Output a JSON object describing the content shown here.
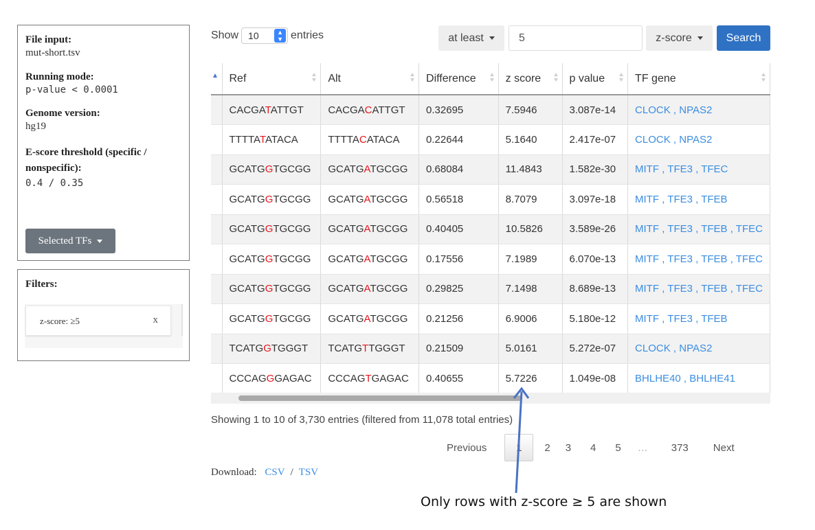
{
  "panel": {
    "file_input_label": "File input:",
    "file_input_value": "mut-short.tsv",
    "running_mode_label": "Running mode:",
    "running_mode_value": "p-value < 0.0001",
    "genome_label": "Genome version:",
    "genome_value": "hg19",
    "escore_label": "E-score threshold (specific / nonspecific):",
    "escore_value": "0.4 / 0.35",
    "selected_tfs_label": "Selected TFs"
  },
  "filters": {
    "title": "Filters:",
    "tag_text": "z-score: ≥5",
    "tag_close": "x"
  },
  "controls": {
    "show_label": "Show",
    "entries_value": "10",
    "entries_label": "entries",
    "at_least_label": "at least",
    "threshold_value": "5",
    "metric_label": "z-score",
    "search_label": "Search"
  },
  "table": {
    "headers": [
      "Ref",
      "Alt",
      "Difference",
      "z score",
      "p value",
      "TF gene"
    ],
    "rows": [
      {
        "ref": [
          "CACGA",
          "T",
          "ATTGT"
        ],
        "alt": [
          "CACGA",
          "C",
          "ATTGT"
        ],
        "diff": "0.32695",
        "z": "7.5946",
        "p": "3.087e-14",
        "tfs": [
          "CLOCK",
          "NPAS2"
        ]
      },
      {
        "ref": [
          "TTTTA",
          "T",
          "ATACA"
        ],
        "alt": [
          "TTTTA",
          "C",
          "ATACA"
        ],
        "diff": "0.22644",
        "z": "5.1640",
        "p": "2.417e-07",
        "tfs": [
          "CLOCK",
          "NPAS2"
        ]
      },
      {
        "ref": [
          "GCATG",
          "G",
          "TGCGG"
        ],
        "alt": [
          "GCATG",
          "A",
          "TGCGG"
        ],
        "diff": "0.68084",
        "z": "11.4843",
        "p": "1.582e-30",
        "tfs": [
          "MITF",
          "TFE3",
          "TFEC"
        ]
      },
      {
        "ref": [
          "GCATG",
          "G",
          "TGCGG"
        ],
        "alt": [
          "GCATG",
          "A",
          "TGCGG"
        ],
        "diff": "0.56518",
        "z": "8.7079",
        "p": "3.097e-18",
        "tfs": [
          "MITF",
          "TFE3",
          "TFEB"
        ]
      },
      {
        "ref": [
          "GCATG",
          "G",
          "TGCGG"
        ],
        "alt": [
          "GCATG",
          "A",
          "TGCGG"
        ],
        "diff": "0.40405",
        "z": "10.5826",
        "p": "3.589e-26",
        "tfs": [
          "MITF",
          "TFE3",
          "TFEB",
          "TFEC"
        ]
      },
      {
        "ref": [
          "GCATG",
          "G",
          "TGCGG"
        ],
        "alt": [
          "GCATG",
          "A",
          "TGCGG"
        ],
        "diff": "0.17556",
        "z": "7.1989",
        "p": "6.070e-13",
        "tfs": [
          "MITF",
          "TFE3",
          "TFEB",
          "TFEC"
        ]
      },
      {
        "ref": [
          "GCATG",
          "G",
          "TGCGG"
        ],
        "alt": [
          "GCATG",
          "A",
          "TGCGG"
        ],
        "diff": "0.29825",
        "z": "7.1498",
        "p": "8.689e-13",
        "tfs": [
          "MITF",
          "TFE3",
          "TFEB",
          "TFEC"
        ]
      },
      {
        "ref": [
          "GCATG",
          "G",
          "TGCGG"
        ],
        "alt": [
          "GCATG",
          "A",
          "TGCGG"
        ],
        "diff": "0.21256",
        "z": "6.9006",
        "p": "5.180e-12",
        "tfs": [
          "MITF",
          "TFE3",
          "TFEB"
        ]
      },
      {
        "ref": [
          "TCATG",
          "G",
          "TGGGT"
        ],
        "alt": [
          "TCATG",
          "T",
          "TGGGT"
        ],
        "diff": "0.21509",
        "z": "5.0161",
        "p": "5.272e-07",
        "tfs": [
          "CLOCK",
          "NPAS2"
        ]
      },
      {
        "ref": [
          "CCCAG",
          "G",
          "GAGAC"
        ],
        "alt": [
          "CCCAG",
          "T",
          "GAGAC"
        ],
        "diff": "0.40655",
        "z": "5.7226",
        "p": "1.049e-08",
        "tfs": [
          "BHLHE40",
          "BHLHE41"
        ]
      }
    ]
  },
  "info_text": "Showing 1 to 10 of 3,730 entries (filtered from 11,078 total entries)",
  "pagination": {
    "previous": "Previous",
    "pages": [
      "1",
      "2",
      "3",
      "4",
      "5"
    ],
    "ellipsis": "…",
    "last": "373",
    "next": "Next"
  },
  "download": {
    "label": "Download:",
    "csv": "CSV",
    "slash": "/",
    "tsv": "TSV"
  },
  "annotation": {
    "caption": "Only rows with z-score ≥ 5 are shown",
    "arrow_color": "#4a72c4"
  },
  "colors": {
    "mutation": "#e8141c",
    "link": "#3b8de0",
    "search_button": "#2f72c4",
    "selected_tfs_button": "#6c757d"
  }
}
